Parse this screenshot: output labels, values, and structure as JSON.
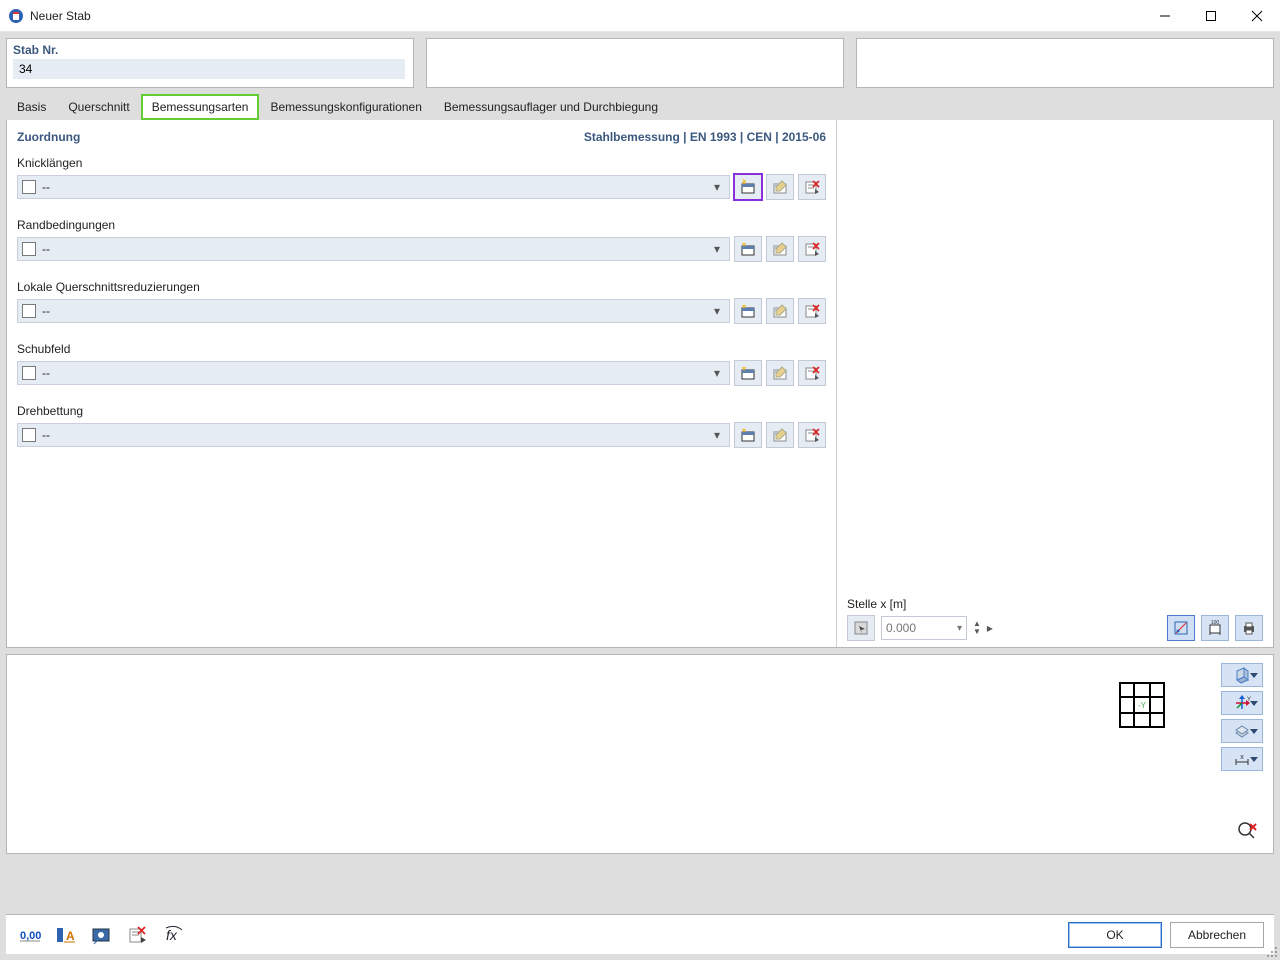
{
  "window": {
    "title": "Neuer Stab"
  },
  "header": {
    "stab_nr_label": "Stab Nr.",
    "stab_nr_value": "34"
  },
  "tabs": {
    "basis": "Basis",
    "querschnitt": "Querschnitt",
    "bemessungsarten": "Bemessungsarten",
    "bemessungskonfigurationen": "Bemessungskonfigurationen",
    "bemessungsauflager": "Bemessungsauflager und Durchbiegung"
  },
  "panel": {
    "zuordnung": "Zuordnung",
    "norm": "Stahlbemessung | EN 1993 | CEN | 2015-06"
  },
  "sections": {
    "knicklangen": {
      "label": "Knicklängen",
      "value": "--"
    },
    "randbedingungen": {
      "label": "Randbedingungen",
      "value": "--"
    },
    "lokale": {
      "label": "Lokale Querschnittsreduzierungen",
      "value": "--"
    },
    "schubfeld": {
      "label": "Schubfeld",
      "value": "--"
    },
    "drehbettung": {
      "label": "Drehbettung",
      "value": "--"
    }
  },
  "right": {
    "stellex_label": "Stelle x [m]",
    "stellex_value": "0.000"
  },
  "buttons": {
    "ok": "OK",
    "cancel": "Abbrechen"
  }
}
